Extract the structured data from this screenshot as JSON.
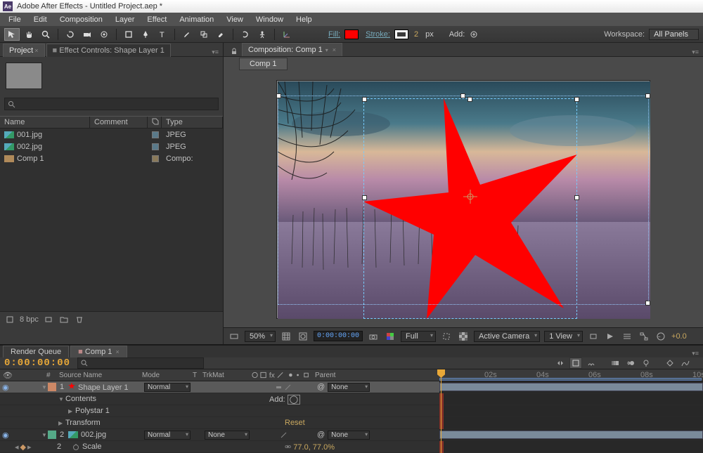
{
  "title": "Adobe After Effects - Untitled Project.aep *",
  "menu": [
    "File",
    "Edit",
    "Composition",
    "Layer",
    "Effect",
    "Animation",
    "View",
    "Window",
    "Help"
  ],
  "shape_opts": {
    "fill_label": "Fill:",
    "stroke_label": "Stroke:",
    "stroke_px": "2",
    "px": "px",
    "add_label": "Add:"
  },
  "workspace": {
    "label": "Workspace:",
    "value": "All Panels"
  },
  "panels": {
    "project_tab": "Project",
    "fx_tab": "Effect Controls: Shape Layer 1",
    "cols": {
      "name": "Name",
      "comment": "Comment",
      "type": "Type"
    },
    "items": [
      {
        "name": "001.jpg",
        "type": "JPEG",
        "icon": "img"
      },
      {
        "name": "002.jpg",
        "type": "JPEG",
        "icon": "img"
      },
      {
        "name": "Comp 1",
        "type": "Compo:",
        "icon": "cmp"
      }
    ],
    "bpc": "8 bpc"
  },
  "comp": {
    "panel_label": "Composition: Comp 1",
    "tab": "Comp 1",
    "magnif": "50%",
    "timecode": "0:00:00:00",
    "res": "Full",
    "camera": "Active Camera",
    "views": "1 View",
    "exposure": "+0.0"
  },
  "timeline": {
    "render_tab": "Render Queue",
    "comp_tab": "Comp 1",
    "timecode": "0:00:00:00",
    "columns": {
      "num": "#",
      "src": "Source Name",
      "mode": "Mode",
      "t": "T",
      "trkmat": "TrkMat",
      "parent": "Parent"
    },
    "add": "Add:",
    "reset": "Reset",
    "ruler": [
      "02s",
      "04s",
      "06s",
      "08s",
      "10s"
    ],
    "layers": [
      {
        "num": "1",
        "name": "Shape Layer 1",
        "mode": "Normal",
        "parent": "None",
        "icon": "shape"
      },
      {
        "contents": "Contents"
      },
      {
        "polystar": "Polystar 1"
      },
      {
        "transform": "Transform"
      },
      {
        "num": "2",
        "name": "002.jpg",
        "mode": "Normal",
        "trkmat": "None",
        "parent": "None",
        "icon": "img"
      },
      {
        "scale": "Scale",
        "val": "77.0, 77.0%",
        "kf": "2"
      }
    ]
  }
}
